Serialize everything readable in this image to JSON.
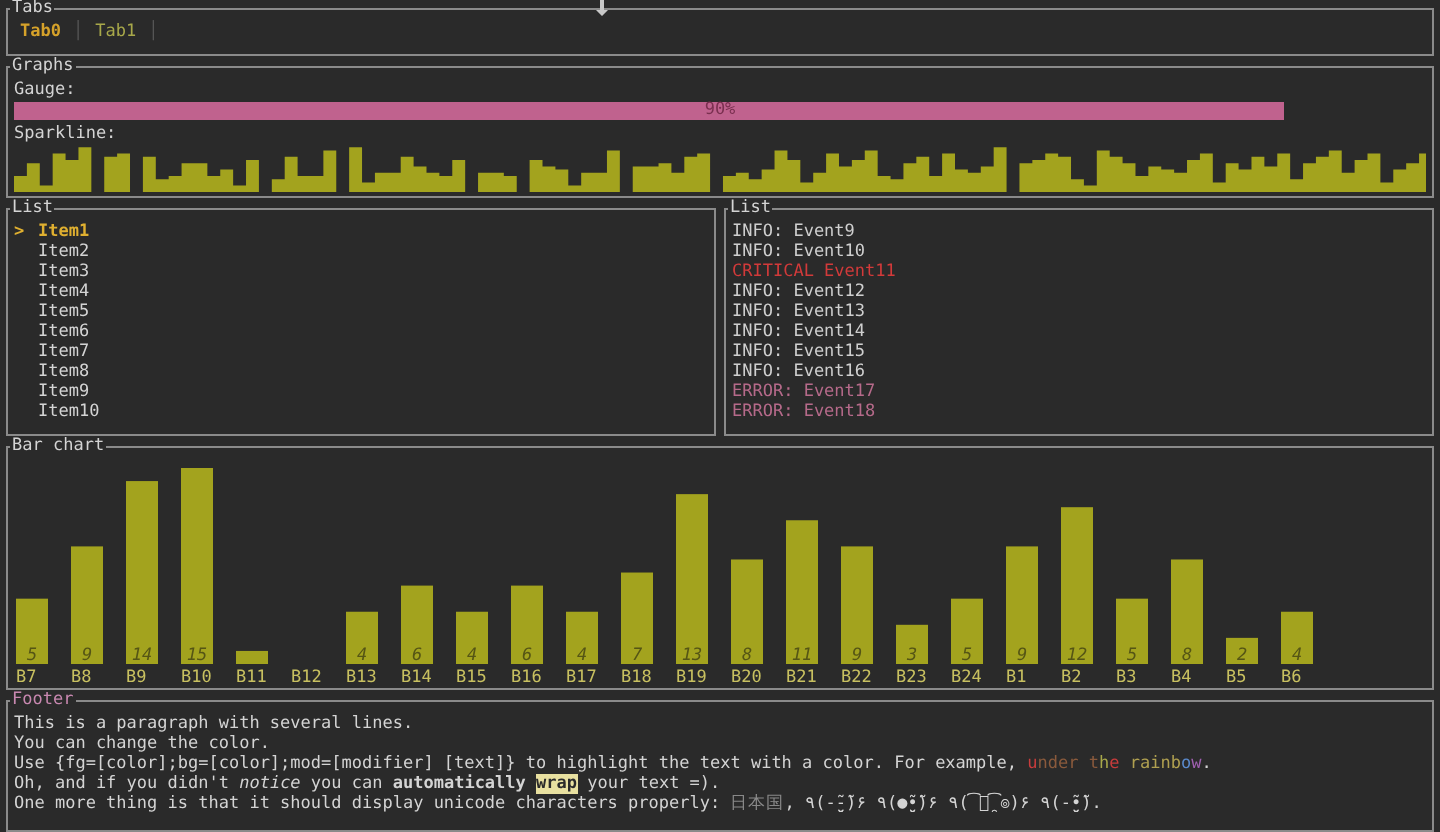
{
  "tabs": {
    "title": "Tabs",
    "separator": "│",
    "items": [
      {
        "label": "Tab0",
        "selected": true
      },
      {
        "label": "Tab1",
        "selected": false
      }
    ]
  },
  "graphs": {
    "title": "Graphs",
    "gauge": {
      "label": "Gauge:",
      "level": 0.9,
      "reading": "90%"
    },
    "sparkline": {
      "label": "Sparkline:"
    }
  },
  "list": {
    "title": "List",
    "highlight_symbol": ">",
    "items": [
      {
        "label": "Item1",
        "selected": true
      },
      {
        "label": "Item2",
        "selected": false
      },
      {
        "label": "Item3",
        "selected": false
      },
      {
        "label": "Item4",
        "selected": false
      },
      {
        "label": "Item5",
        "selected": false
      },
      {
        "label": "Item6",
        "selected": false
      },
      {
        "label": "Item7",
        "selected": false
      },
      {
        "label": "Item8",
        "selected": false
      },
      {
        "label": "Item9",
        "selected": false
      },
      {
        "label": "Item10",
        "selected": false
      }
    ]
  },
  "events": {
    "title": "List",
    "items": [
      {
        "kind": "info",
        "text": "INFO: Event9"
      },
      {
        "kind": "info",
        "text": "INFO: Event10"
      },
      {
        "kind": "critical",
        "text": "CRITICAL  Event11"
      },
      {
        "kind": "info",
        "text": "INFO: Event12"
      },
      {
        "kind": "info",
        "text": "INFO: Event13"
      },
      {
        "kind": "info",
        "text": "INFO: Event14"
      },
      {
        "kind": "info",
        "text": "INFO: Event15"
      },
      {
        "kind": "info",
        "text": "INFO: Event16"
      },
      {
        "kind": "error",
        "text": "ERROR: Event17"
      },
      {
        "kind": "error",
        "text": "ERROR: Event18"
      }
    ]
  },
  "bar_chart": {
    "title": "Bar chart",
    "chart_data": {
      "type": "bar",
      "categories": [
        "B7",
        "B8",
        "B9",
        "B10",
        "B11",
        "B12",
        "B13",
        "B14",
        "B15",
        "B16",
        "B17",
        "B18",
        "B19",
        "B20",
        "B21",
        "B22",
        "B23",
        "B24",
        "B1",
        "B2",
        "B3",
        "B4",
        "B5",
        "B6"
      ],
      "values": [
        5,
        9,
        14,
        15,
        1,
        0,
        4,
        6,
        4,
        6,
        4,
        7,
        13,
        8,
        11,
        9,
        3,
        5,
        9,
        12,
        5,
        8,
        2,
        4
      ],
      "value_labels": [
        "5",
        "9",
        "14",
        "15",
        null,
        null,
        "4",
        "6",
        "4",
        "6",
        "4",
        "7",
        "13",
        "8",
        "11",
        "9",
        "3",
        "5",
        "9",
        "12",
        "5",
        "8",
        "2",
        "4"
      ]
    }
  },
  "footer": {
    "title": "Footer",
    "lines": [
      [
        {
          "kind": "plain",
          "text": "This is a paragraph with several lines."
        }
      ],
      [
        {
          "kind": "plain",
          "text": "You can change the color."
        }
      ],
      [
        {
          "kind": "plain",
          "text": "Use {fg=[color];bg=[color];mod=[modifier] [text]} to highlight the text with a color. For example, "
        },
        {
          "kind": "color",
          "text": "u",
          "color": "#c83c3c"
        },
        {
          "kind": "color",
          "text": "nder t",
          "color": "#8a5a3c"
        },
        {
          "kind": "color",
          "text": "h",
          "color": "#a8a84a"
        },
        {
          "kind": "color",
          "text": "e",
          "color": "#c83c3c"
        },
        {
          "kind": "color",
          "text": " rainb",
          "color": "#b0a050"
        },
        {
          "kind": "color",
          "text": "o",
          "color": "#5a8acd"
        },
        {
          "kind": "color",
          "text": "w",
          "color": "#a060b0"
        },
        {
          "kind": "plain",
          "text": "."
        }
      ],
      [
        {
          "kind": "plain",
          "text": "Oh, and if you didn't "
        },
        {
          "kind": "italic",
          "text": "notice"
        },
        {
          "kind": "plain",
          "text": " you can "
        },
        {
          "kind": "bold",
          "text": "automatically "
        },
        {
          "kind": "highlight",
          "text": "wrap"
        },
        {
          "kind": "plain",
          "text": " your text =)."
        }
      ],
      [
        {
          "kind": "plain",
          "text": "One more thing is that it should display unicode characters properly: "
        },
        {
          "kind": "dim",
          "text": "日本国"
        },
        {
          "kind": "plain",
          "text": ", ٩(-̮̮̃-̃)۶ ٩(●̮̮̃•̃)۶ ٩(͡๏̯͡๏)۶ ٩(-̮̮̃•̃)."
        }
      ]
    ]
  }
}
